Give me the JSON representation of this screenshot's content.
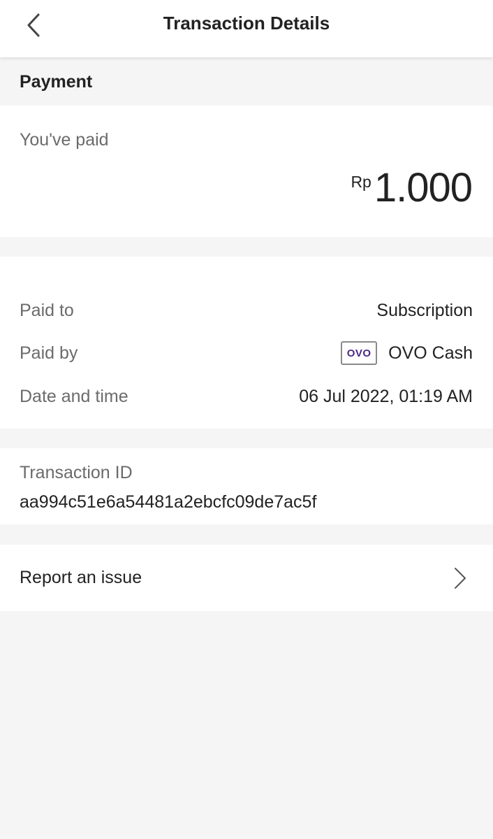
{
  "header": {
    "title": "Transaction Details",
    "back_icon": "chevron-left-icon"
  },
  "payment": {
    "section_label": "Payment",
    "paid_label": "You've paid",
    "currency": "Rp",
    "amount": "1.000"
  },
  "details": {
    "rows": [
      {
        "label": "Paid to",
        "value": "Subscription"
      },
      {
        "label": "Paid by",
        "value": "OVO Cash",
        "badge": "OVO",
        "badge_color": "#4c2a86"
      },
      {
        "label": "Date and time",
        "value": "06 Jul 2022, 01:19 AM"
      }
    ]
  },
  "transaction": {
    "id_label": "Transaction ID",
    "id_value": "aa994c51e6a54481a2ebcfc09de7ac5f"
  },
  "report": {
    "label": "Report an issue",
    "icon": "chevron-right-icon"
  }
}
